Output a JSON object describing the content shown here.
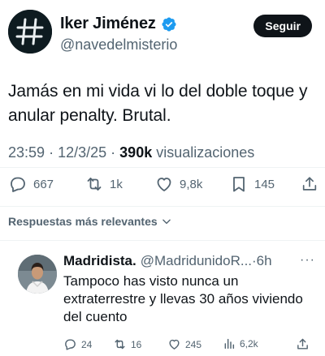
{
  "tweet": {
    "author_name": "Iker Jiménez",
    "author_handle": "@navedelmisterio",
    "follow_label": "Seguir",
    "text": "Jamás en mi vida vi lo del doble toque y anular penalty. Brutal.",
    "time": "23:59",
    "date": "12/3/25",
    "separator": "·",
    "views_count": "390k",
    "views_label": "visualizaciones",
    "counts": {
      "replies": "667",
      "retweets": "1k",
      "likes": "9,8k",
      "bookmarks": "145"
    }
  },
  "replies_header": {
    "label": "Respuestas más relevantes"
  },
  "reply": {
    "author_name": "Madridista.",
    "author_handle": "@MadridunidoR...",
    "time": "·6h",
    "more": "···",
    "text": "Tampoco has visto nunca un extraterrestre y llevas 30 años viviendo del cuento",
    "counts": {
      "replies": "24",
      "retweets": "16",
      "likes": "245",
      "views": "6,2k"
    }
  },
  "colors": {
    "text_primary": "#0f1419",
    "text_secondary": "#536471",
    "verified": "#1d9bf0",
    "divider": "#eff3f4"
  },
  "icons": {
    "verified": "verified-badge-icon",
    "reply": "reply-icon",
    "retweet": "retweet-icon",
    "like": "heart-icon",
    "bookmark": "bookmark-icon",
    "share": "share-icon",
    "views": "views-chart-icon",
    "chevron": "chevron-down-icon",
    "more": "more-icon"
  }
}
